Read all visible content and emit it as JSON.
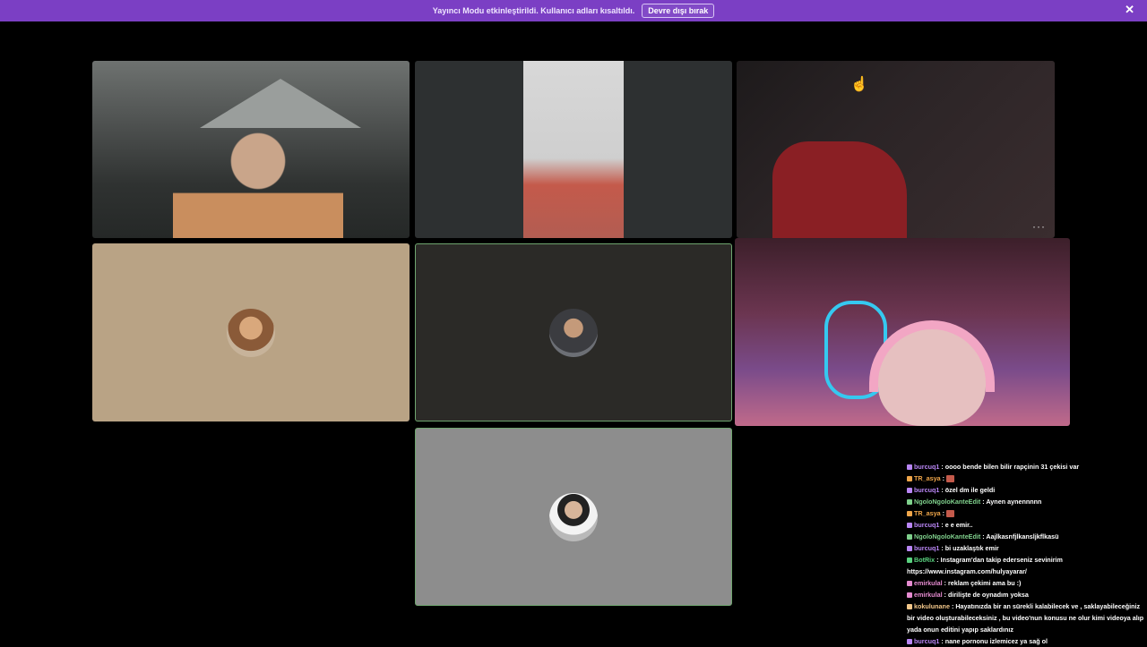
{
  "banner": {
    "message": "Yayıncı Modu etkinleştirildi. Kullanıcı adları kısaltıldı.",
    "button": "Devre dışı bırak",
    "close": "✕"
  },
  "tiles": {
    "more_label": "···"
  },
  "chat": {
    "messages": [
      {
        "user": "burcuq1",
        "color": "#b986f5",
        "text": ": oooo bende bilen bilir rapçinin 31 çekisi var"
      },
      {
        "user": "TR_asya",
        "color": "#f0a64a",
        "text": ": ",
        "emote": true
      },
      {
        "user": "burcuq1",
        "color": "#b986f5",
        "text": ": özel dm ile geldi"
      },
      {
        "user": "NgoloNgoloKanteEdit",
        "color": "#7fd08c",
        "text": ": Aynen aynennnnn"
      },
      {
        "user": "TR_asya",
        "color": "#f0a64a",
        "text": ": ",
        "emote": true
      },
      {
        "user": "burcuq1",
        "color": "#b986f5",
        "text": ": e e emir.."
      },
      {
        "user": "NgoloNgoloKanteEdit",
        "color": "#7fd08c",
        "text": ": Aajlkasnfjlkansljkflkasü"
      },
      {
        "user": "burcuq1",
        "color": "#b986f5",
        "text": ": bi uzaklaştık emir"
      },
      {
        "user": "BotRix",
        "color": "#5ad17f",
        "text": ": Instagram'dan takip ederseniz sevinirim https://www.instagram.com/hulyayarar/"
      },
      {
        "user": "emirkulal",
        "color": "#e58bd0",
        "text": ": reklam çekimi ama bu :)"
      },
      {
        "user": "emirkulal",
        "color": "#e58bd0",
        "text": ": dirilişte de oynadım yoksa"
      },
      {
        "user": "kokulunane",
        "color": "#f3c78a",
        "text": ": Hayatınızda bir an sürekli kalabilecek ve , saklayabileceğiniz bir video oluşturabileceksiniz , bu video'nun konusu ne olur kimi videoya alıp yada onun editini yapıp saklardınız"
      },
      {
        "user": "burcuq1",
        "color": "#b986f5",
        "text": ": nane pornonu izlemicez ya sağ ol"
      }
    ]
  }
}
